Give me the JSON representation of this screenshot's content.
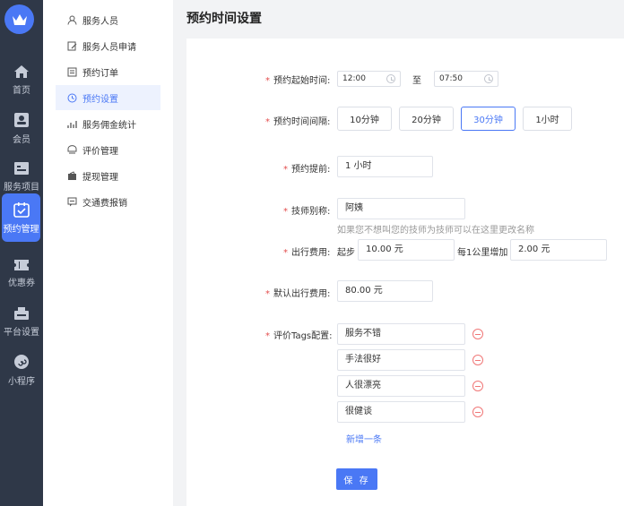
{
  "rail": {
    "items": [
      {
        "label": "首页"
      },
      {
        "label": "会员"
      },
      {
        "label": "服务项目"
      },
      {
        "label": "预约管理"
      },
      {
        "label": "优惠券"
      },
      {
        "label": "平台设置"
      },
      {
        "label": "小程序"
      }
    ],
    "accent": "#4a78f5"
  },
  "subnav": {
    "items": [
      {
        "label": "服务人员"
      },
      {
        "label": "服务人员申请"
      },
      {
        "label": "预约订单"
      },
      {
        "label": "预约设置"
      },
      {
        "label": "服务佣金统计"
      },
      {
        "label": "评价管理"
      },
      {
        "label": "提现管理"
      },
      {
        "label": "交通费报销"
      }
    ]
  },
  "page": {
    "title": "预约时间设置"
  },
  "form": {
    "start_time": {
      "label": "预约起始时间:",
      "from": "12:00",
      "to_sep": "至",
      "to": "07:50"
    },
    "interval": {
      "label": "预约时间间隔:",
      "options": [
        "10分钟",
        "20分钟",
        "30分钟",
        "1小时"
      ],
      "selected": "30分钟"
    },
    "advance": {
      "label": "预约提前:",
      "value": "1 小时"
    },
    "alias": {
      "label": "技师别称:",
      "value": "阿姨",
      "hint": "如果您不想叫您的技师为技师可以在这里更改名称"
    },
    "fee": {
      "label": "出行费用:",
      "start_label": "起步",
      "start_value": "10.00 元",
      "per_label": "每1公里增加",
      "per_value": "2.00 元"
    },
    "default_fee": {
      "label": "默认出行费用:",
      "value": "80.00 元"
    },
    "tags": {
      "label": "评价Tags配置:",
      "items": [
        "服务不错",
        "手法很好",
        "人很漂亮",
        "很健谈"
      ],
      "add_label": "新增一条"
    },
    "save_label": "保 存"
  }
}
